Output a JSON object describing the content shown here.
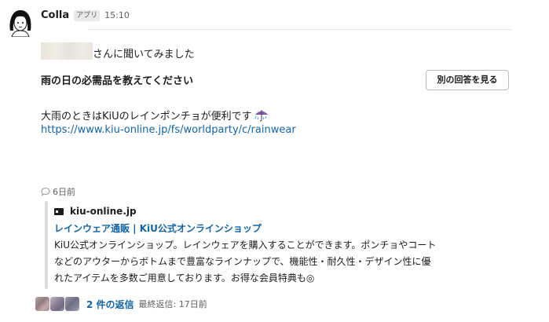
{
  "message": {
    "sender": "Colla",
    "badge": "アプリ",
    "time": "15:10",
    "line1_suffix": "さんに聞いてみました",
    "question": "雨の日の必需品を教えてください",
    "alt_button": "別の回答を見る",
    "answer": "大雨のときはKiUのレインポンチョが便利です",
    "answer_emoji": "umbrella-with-rain-icon",
    "url": "https://www.kiu-online.jp/fs/worldparty/c/rainwear"
  },
  "attachment": {
    "timestamp": "6日前",
    "domain": "kiu-online.jp",
    "title": "レインウェア通販 | KiU公式オンラインショップ",
    "desc_line1": "KiU公式オンラインショップ。レインウェアを購入することができます。ポンチョやコート",
    "desc_line2": "などのアウターからボトムまで豊富なラインナップで、機能性・耐久性・デザイン性に優",
    "desc_line3": "れたアイテムを多数ご用意しております。お得な会員特典も◎"
  },
  "thread": {
    "reply_count": "2 件の返信",
    "last_reply": "最終返信: 17日前"
  },
  "colors": {
    "link": "#1264a3",
    "muted": "#616061",
    "text": "#1d1c1d"
  }
}
